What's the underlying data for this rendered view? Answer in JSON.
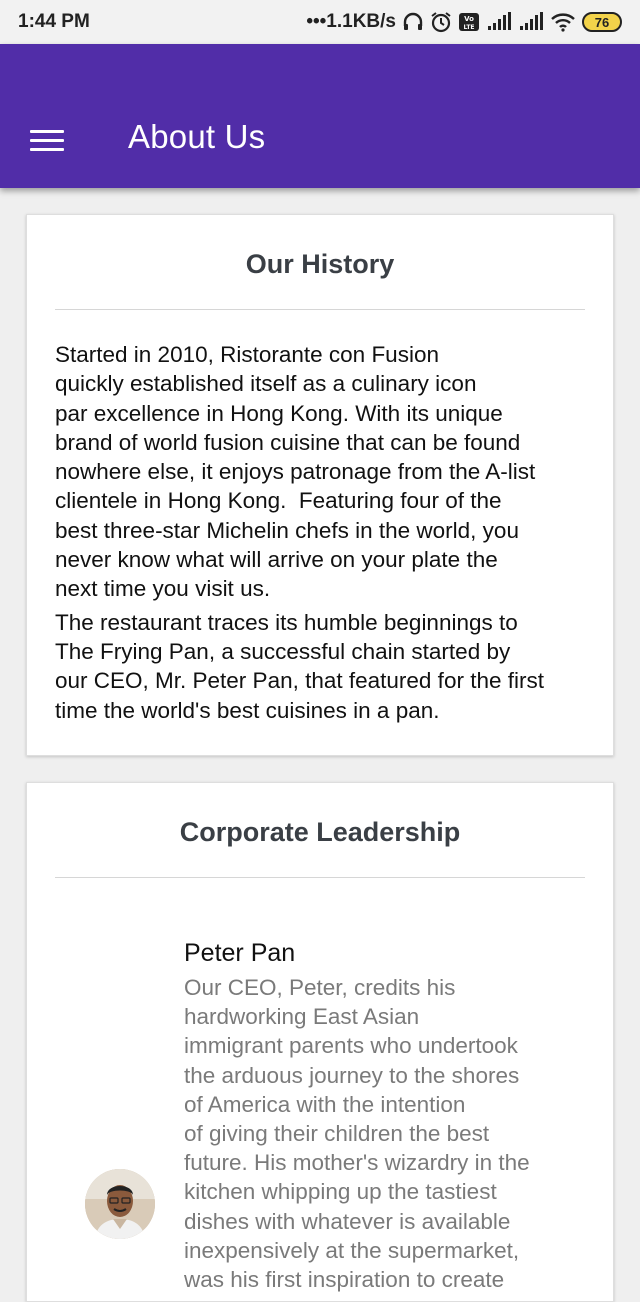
{
  "status_bar": {
    "time": "1:44 PM",
    "net_speed": "•••1.1KB/s",
    "battery": "76",
    "icons": [
      "headphones-icon",
      "alarm-icon",
      "volte-icon",
      "signal-icon",
      "signal-icon",
      "wifi-icon",
      "battery-icon"
    ]
  },
  "app_bar": {
    "title": "About Us",
    "menu_icon": "hamburger-menu-icon",
    "color": "#512da8"
  },
  "history": {
    "title": "Our History",
    "paragraph1_lines": [
      "Started in 2010, Ristorante con Fusion",
      "quickly established itself as a culinary icon",
      "par excellence in Hong Kong. With its unique",
      "brand of world fusion cuisine that can be found",
      "nowhere else, it enjoys patronage from the A-list",
      "clientele in Hong Kong.  Featuring four of the",
      "best three-star Michelin chefs in the world, you",
      "never know what will arrive on your plate the",
      "next time you visit us."
    ],
    "paragraph2_lines": [
      "The restaurant traces its humble beginnings to",
      "The Frying Pan, a successful chain started by",
      "our CEO, Mr. Peter Pan, that featured for the first",
      "time the world's best cuisines in a pan."
    ]
  },
  "leadership": {
    "title": "Corporate Leadership",
    "leaders": [
      {
        "name": "Peter Pan",
        "avatar": "avatar-photo",
        "description_lines": [
          "Our CEO, Peter, credits his",
          "hardworking East Asian",
          "immigrant parents who undertook",
          "the arduous journey to the shores",
          "of America with the intention",
          "of giving their children the best",
          "future. His mother's wizardry in the",
          "kitchen whipping up the tastiest",
          "dishes with whatever is available",
          "inexpensively at the supermarket,",
          "was his first inspiration to create"
        ]
      }
    ]
  }
}
